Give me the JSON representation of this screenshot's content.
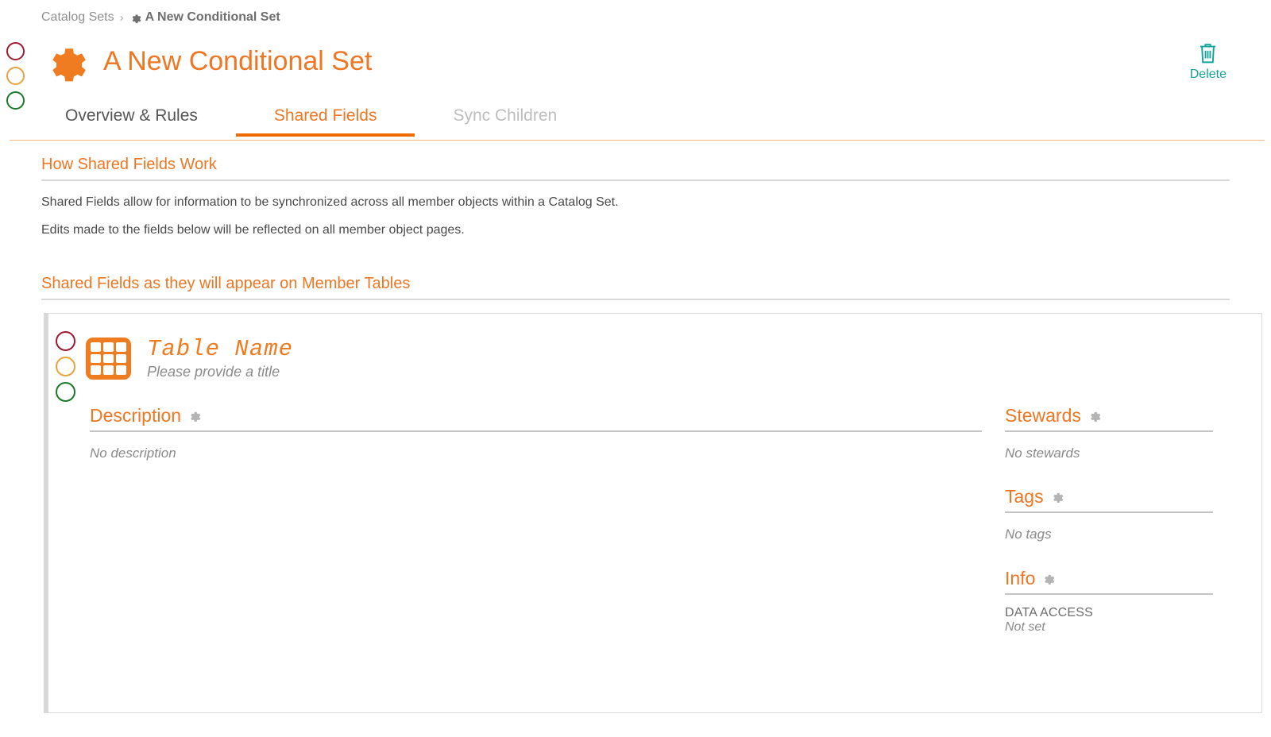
{
  "breadcrumb": {
    "parent": "Catalog Sets",
    "separator": "›",
    "current": "A New Conditional Set",
    "current_icon": "gear-icon"
  },
  "header": {
    "icon": "gear-icon",
    "title": "A New Conditional Set",
    "delete": {
      "icon": "trash-icon",
      "label": "Delete"
    }
  },
  "status_dots": [
    {
      "name": "red-status-dot",
      "color": "#9e1b32"
    },
    {
      "name": "amber-status-dot",
      "color": "#e8a33d"
    },
    {
      "name": "green-status-dot",
      "color": "#1b7a28"
    }
  ],
  "tabs": [
    {
      "label": "Overview & Rules",
      "state": "inactive"
    },
    {
      "label": "Shared Fields",
      "state": "active"
    },
    {
      "label": "Sync Children",
      "state": "disabled"
    }
  ],
  "how_section": {
    "title": "How Shared Fields Work",
    "paragraphs": [
      "Shared Fields allow for information to be synchronized across all member objects within a Catalog Set.",
      "Edits made to the fields below will be reflected on all member object pages."
    ]
  },
  "preview_section": {
    "title": "Shared Fields as they will appear on Member Tables"
  },
  "table_card": {
    "icon": "table-grid-icon",
    "name": "Table Name",
    "subtitle": "Please provide a title",
    "status_dots": [
      {
        "name": "red-status-dot",
        "color": "#9e1b32"
      },
      {
        "name": "amber-status-dot",
        "color": "#e8a33d"
      },
      {
        "name": "green-status-dot",
        "color": "#1b7a28"
      }
    ],
    "description": {
      "label": "Description",
      "gear": "gear-icon",
      "empty_text": "No description"
    },
    "stewards": {
      "label": "Stewards",
      "gear": "gear-icon",
      "empty_text": "No stewards"
    },
    "tags": {
      "label": "Tags",
      "gear": "gear-icon",
      "empty_text": "No tags"
    },
    "info": {
      "label": "Info",
      "gear": "gear-icon",
      "rows": [
        {
          "label": "DATA ACCESS",
          "value": "Not set"
        }
      ]
    }
  },
  "colors": {
    "accent_orange": "#ef7622",
    "accent_orange_dark": "#ef6c00",
    "teal": "#13a39a",
    "rule_gray": "#d9d9d9",
    "text_gray": "#4a4a4a",
    "muted_gray": "#8a8a8a"
  }
}
